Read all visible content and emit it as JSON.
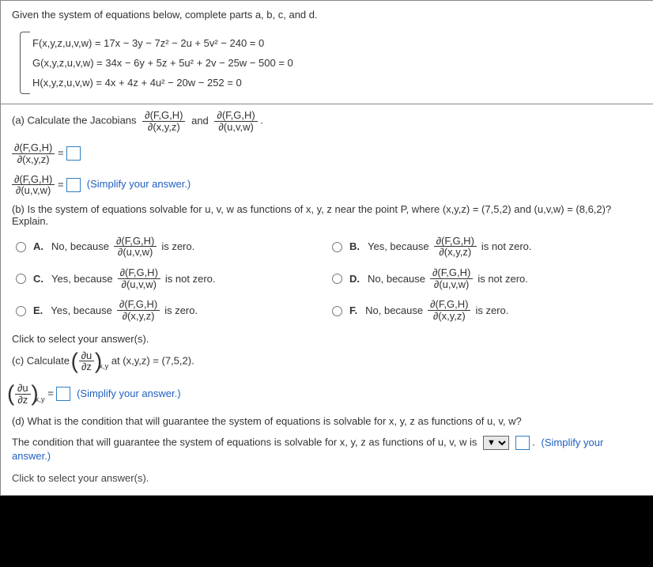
{
  "prompt": "Given the system of equations below, complete parts a, b, c, and d.",
  "equations": {
    "F": "F(x,y,z,u,v,w) = 17x − 3y − 7z² − 2u + 5v² − 240 = 0",
    "G": "G(x,y,z,u,v,w) = 34x − 6y + 5z + 5u² + 2v − 25w − 500 = 0",
    "H": "H(x,y,z,u,v,w) = 4x + 4z + 4u² − 20w − 252 = 0"
  },
  "partA": {
    "lead": "(a) Calculate the Jacobians",
    "and": "and",
    "period": ".",
    "jac1": {
      "num": "∂(F,G,H)",
      "den": "∂(x,y,z)"
    },
    "jac2": {
      "num": "∂(F,G,H)",
      "den": "∂(u,v,w)"
    },
    "eq": " = ",
    "simplify": "(Simplify your answer.)"
  },
  "partB": {
    "question": "(b) Is the system of equations solvable for u, v, w as functions of x, y, z near the point P, where (x,y,z) = (7,5,2) and (u,v,w) = (8,6,2)? Explain.",
    "opts": {
      "A": {
        "pre": "No, because",
        "post": " is zero."
      },
      "B": {
        "pre": "Yes, because",
        "post": " is not zero."
      },
      "C": {
        "pre": "Yes, because",
        "post": " is not zero."
      },
      "D": {
        "pre": "No, because",
        "post": " is not zero."
      },
      "E": {
        "pre": "Yes, because",
        "post": " is zero."
      },
      "F": {
        "pre": "No, because",
        "post": " is zero."
      }
    },
    "jacU": {
      "num": "∂(F,G,H)",
      "den": "∂(u,v,w)"
    },
    "jacX": {
      "num": "∂(F,G,H)",
      "den": "∂(x,y,z)"
    }
  },
  "clickSelect": "Click to select your answer(s).",
  "partC": {
    "lead": "(c) Calculate",
    "tail": " at (x,y,z) = (7,5,2).",
    "deriv": {
      "num": "∂u",
      "den": "∂z"
    },
    "sub": "x,y",
    "eq": " = ",
    "simplify": "(Simplify your answer.)"
  },
  "partD": {
    "q": "(d) What is the condition that will guarantee the system of equations is solvable for x, y, z as functions of u, v, w?",
    "sentence": "The condition that will guarantee the system of equations is solvable for x, y, z as functions of u, v, w is",
    "period": ".",
    "simplify": "(Simplify your answer.)"
  },
  "cutoff": "Click to select your answer(s)."
}
